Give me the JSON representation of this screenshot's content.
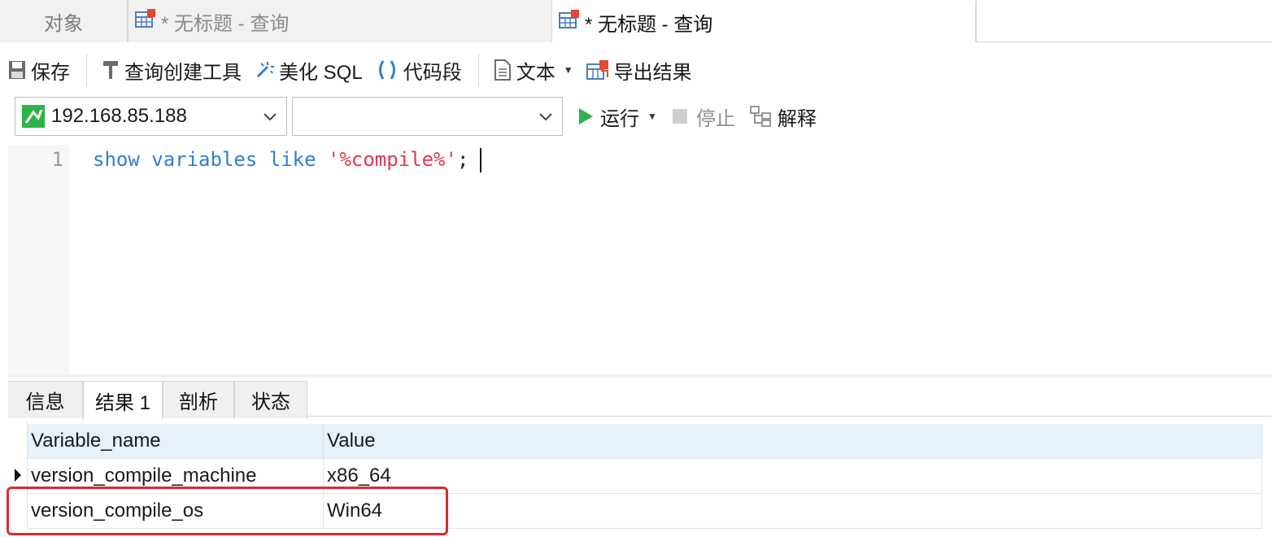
{
  "tabs": {
    "objects": "对象",
    "query1": "* 无标题 - 查询",
    "query2": "* 无标题 - 查询"
  },
  "toolbar": {
    "save": "保存",
    "query_builder": "查询创建工具",
    "beautify": "美化 SQL",
    "snippet": "代码段",
    "text": "文本",
    "export": "导出结果"
  },
  "connection": {
    "host": "192.168.85.188",
    "database": ""
  },
  "actions": {
    "run": "运行",
    "stop": "停止",
    "explain": "解释"
  },
  "editor": {
    "line_number": "1",
    "tokens": {
      "show": "show",
      "variables": "variables",
      "like": "like",
      "pattern": "'%compile%'",
      "semicolon": ";"
    }
  },
  "result_tabs": [
    "信息",
    "结果 1",
    "剖析",
    "状态"
  ],
  "results": {
    "columns": [
      "Variable_name",
      "Value"
    ],
    "rows": [
      [
        "version_compile_machine",
        "x86_64"
      ],
      [
        "version_compile_os",
        "Win64"
      ]
    ]
  },
  "colors": {
    "keyword": "#2e7fd4",
    "string": "#e3394f",
    "highlight_border": "#e0282c",
    "run_green": "#2db34a",
    "header_bg": "#e6f1fa"
  }
}
